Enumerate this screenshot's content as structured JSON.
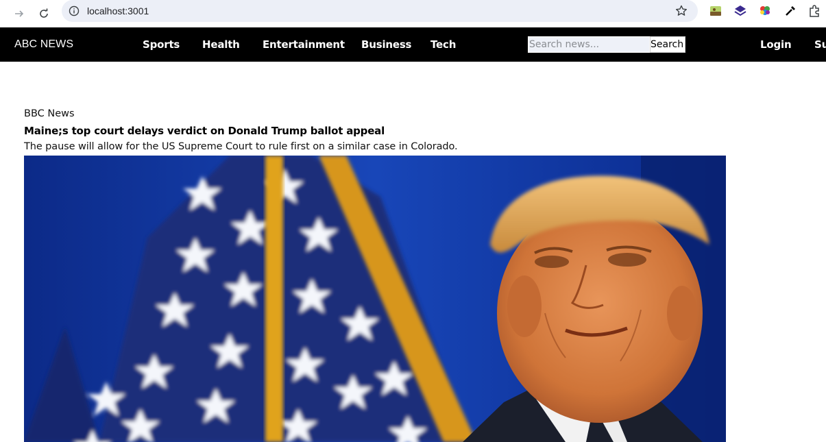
{
  "browser": {
    "url": "localhost:3001"
  },
  "site": {
    "brand": "ABC NEWS",
    "nav_links": [
      "Sports",
      "Health",
      "Entertainment",
      "Business",
      "Tech"
    ],
    "search": {
      "placeholder": "Search news...",
      "button_label": "Search"
    },
    "login_label": "Login",
    "signup_label_partial": "Su"
  },
  "article": {
    "source": "BBC News",
    "headline": "Maine;s top court delays verdict on Donald Trump ballot appeal",
    "summary": "The pause will allow for the US Supreme Court to rule first on a similar case in Colorado."
  },
  "colors": {
    "nav_bg": "#000000",
    "urlbar_bg": "#eceff7",
    "photo_flag_blue": "#1d3f9a",
    "photo_pole_gold": "#d9a21c"
  }
}
